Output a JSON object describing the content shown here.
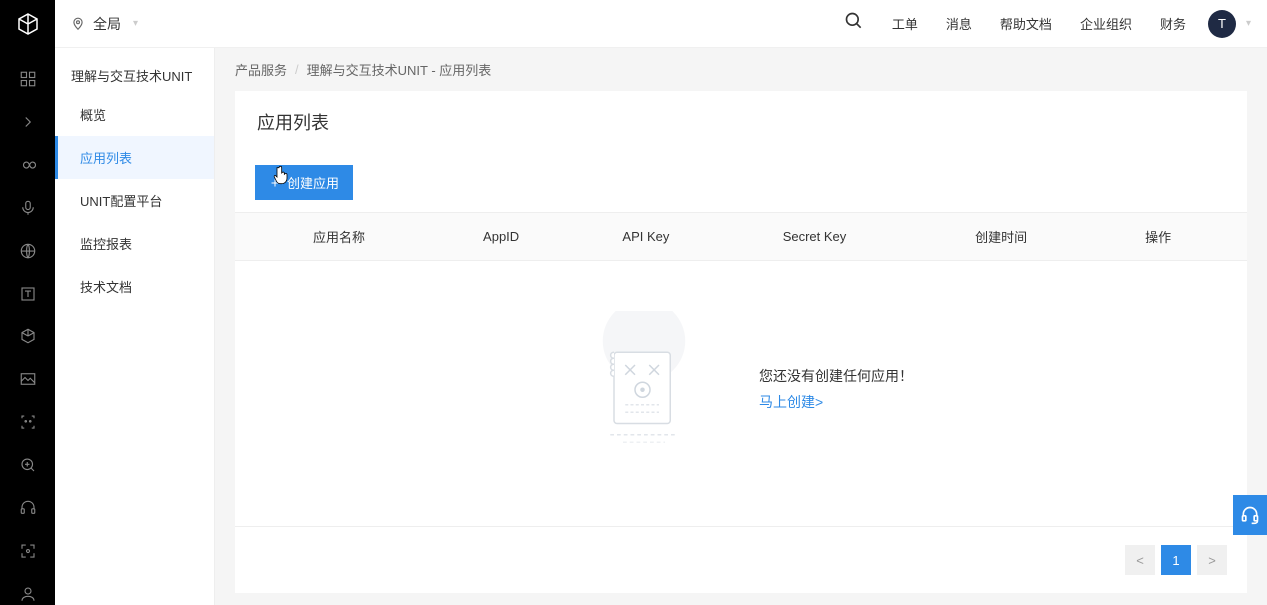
{
  "topbar": {
    "region_label": "全局",
    "links": {
      "ticket": "工单",
      "message": "消息",
      "help": "帮助文档",
      "org": "企业组织",
      "finance": "财务"
    },
    "avatar_initial": "T"
  },
  "sidebar": {
    "title": "理解与交互技术UNIT",
    "items": [
      {
        "label": "概览"
      },
      {
        "label": "应用列表"
      },
      {
        "label": "UNIT配置平台"
      },
      {
        "label": "监控报表"
      },
      {
        "label": "技术文档"
      }
    ]
  },
  "breadcrumb": {
    "root": "产品服务",
    "current": "理解与交互技术UNIT - 应用列表"
  },
  "page": {
    "title": "应用列表"
  },
  "toolbar": {
    "create_label": "创建应用"
  },
  "table": {
    "columns": {
      "name": "应用名称",
      "appid": "AppID",
      "apikey": "API Key",
      "secretkey": "Secret Key",
      "created": "创建时间",
      "action": "操作"
    }
  },
  "empty": {
    "message": "您还没有创建任何应用！",
    "link": "马上创建>"
  },
  "pagination": {
    "prev": "<",
    "page": "1",
    "next": ">"
  }
}
